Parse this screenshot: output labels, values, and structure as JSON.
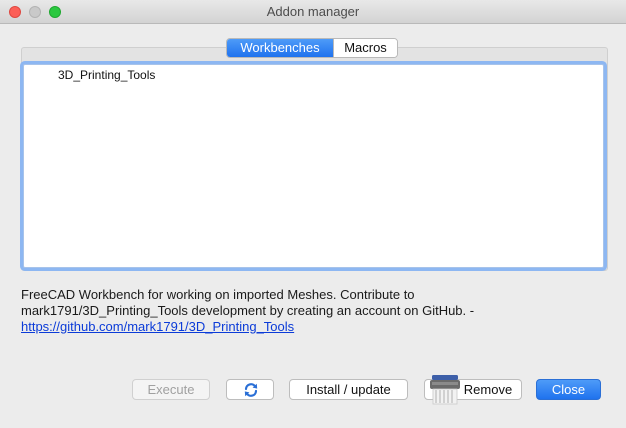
{
  "window": {
    "title": "Addon manager"
  },
  "tabs": [
    {
      "label": "Workbenches",
      "active": true
    },
    {
      "label": "Macros",
      "active": false
    }
  ],
  "list": {
    "items": [
      "3D_Printing_Tools"
    ]
  },
  "description": {
    "text": "FreeCAD Workbench for working on imported Meshes. Contribute to mark1791/3D_Printing_Tools development by creating an account on GitHub. - ",
    "link": "https://github.com/mark1791/3D_Printing_Tools"
  },
  "buttons": {
    "execute": "Execute",
    "install": "Install / update",
    "remove": "Remove",
    "close": "Close"
  },
  "icons": {
    "refresh": "refresh-icon",
    "remove": "shredder-icon"
  },
  "colors": {
    "accent": "#1f72ee",
    "link": "#0b3bd8",
    "focus_ring": "#8db7f2"
  }
}
